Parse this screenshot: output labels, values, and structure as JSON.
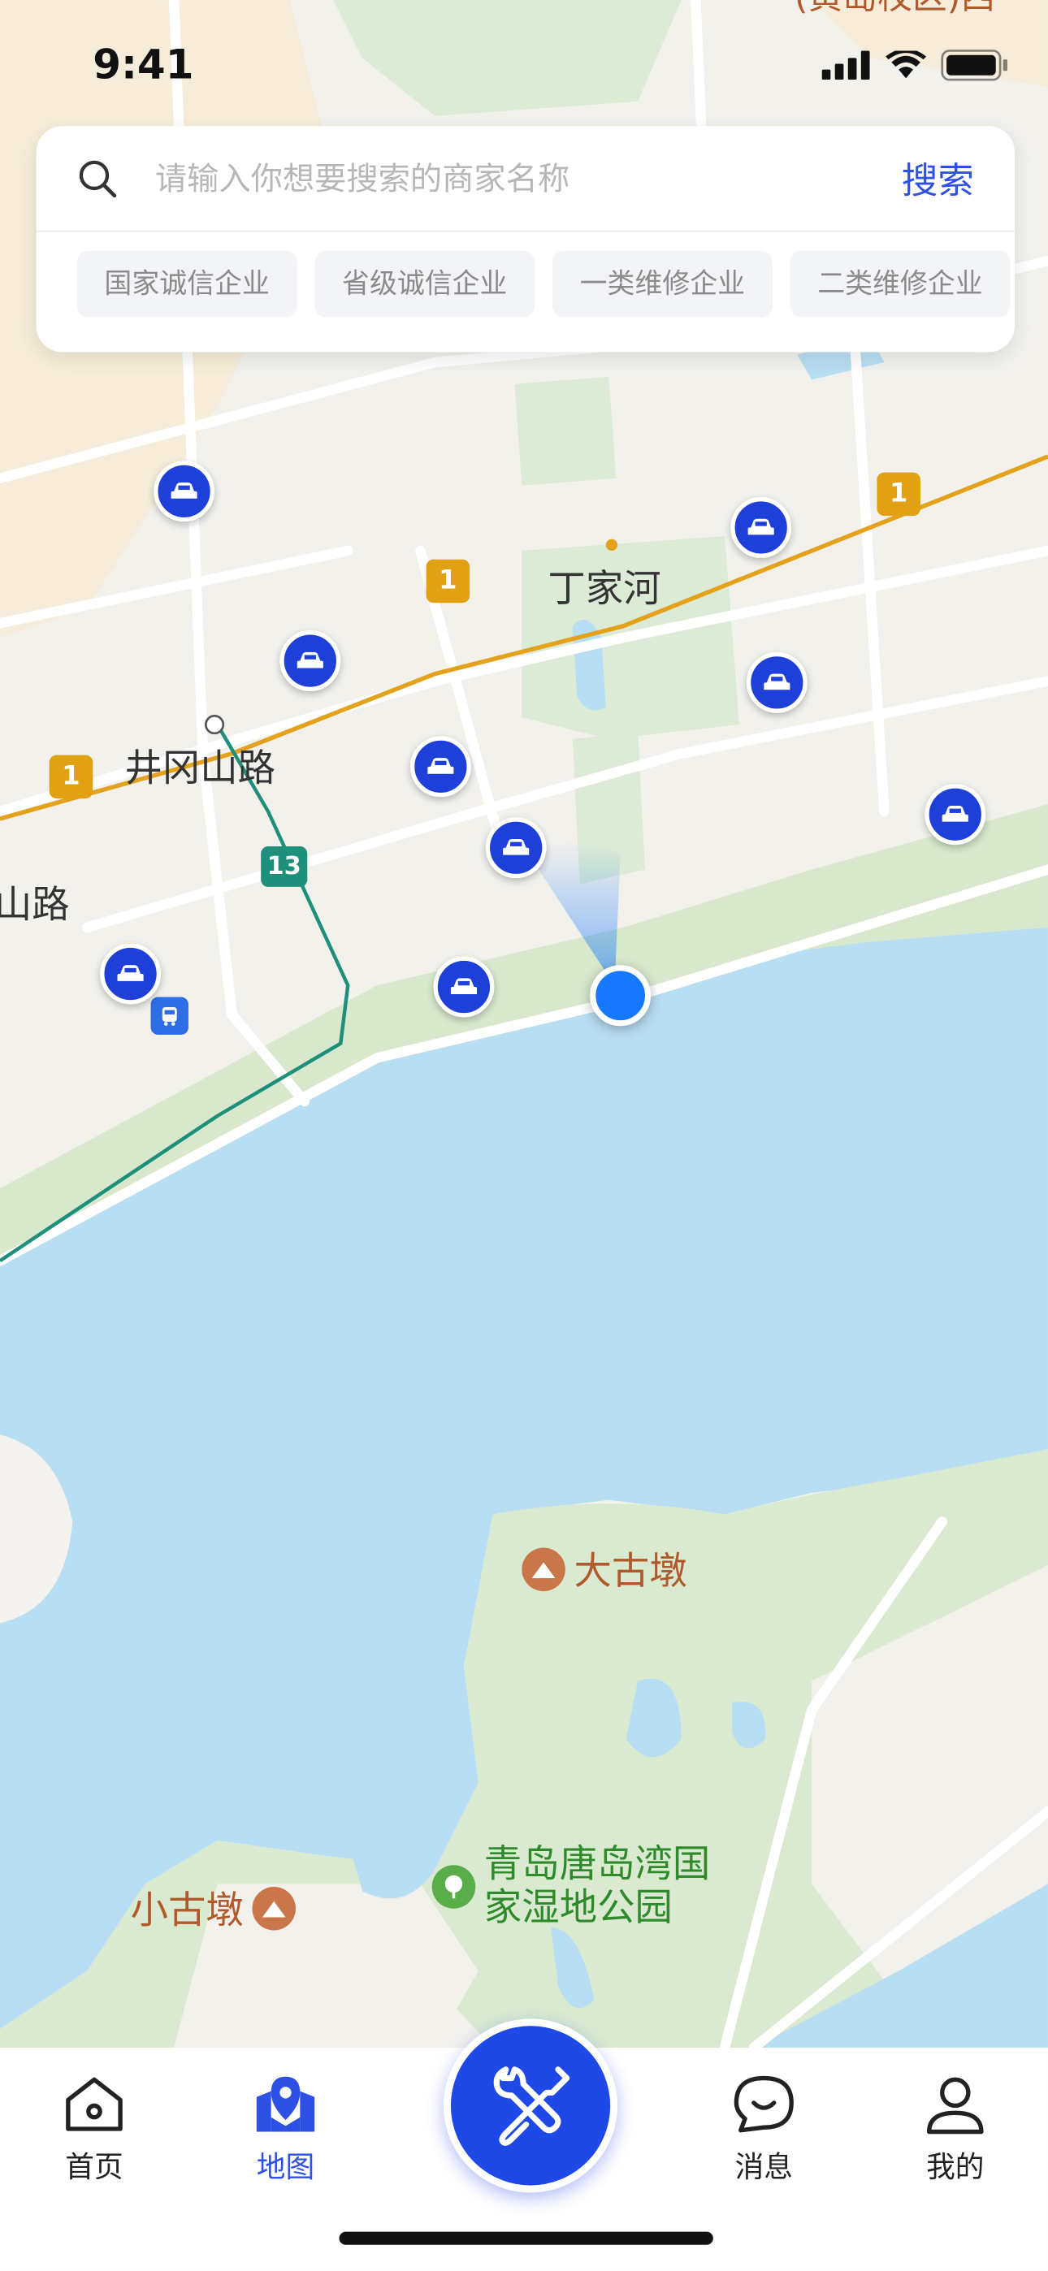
{
  "status_bar": {
    "time": "9:41"
  },
  "search": {
    "placeholder": "请输入你想要搜索的商家名称",
    "button_label": "搜索"
  },
  "filters": [
    "国家诚信企业",
    "省级诚信企业",
    "一类维修企业",
    "二类维修企业"
  ],
  "map": {
    "place_labels": {
      "dingjiahe": "丁家河",
      "jinggangshan_road": "井冈山路",
      "road_partial": "山路",
      "dagudun": "大古墩",
      "xiaogudun": "小古墩",
      "wetland_park_line1": "青岛唐岛湾国",
      "wetland_park_line2": "家湿地公园",
      "top_right_partial": "(黄岛校区)西"
    },
    "route_badges": {
      "line1": "1",
      "line13": "13"
    }
  },
  "tabbar": {
    "home": "首页",
    "map": "地图",
    "messages": "消息",
    "profile": "我的"
  },
  "colors": {
    "accent": "#2f50e5",
    "water": "#b8def3",
    "park": "#d9ead0",
    "car_marker": "#1f3fd9"
  }
}
